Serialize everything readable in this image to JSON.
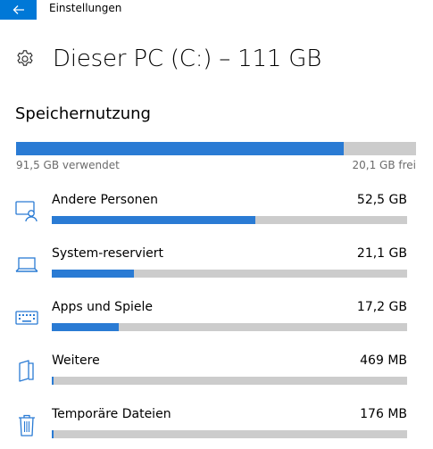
{
  "window": {
    "title": "Einstellungen",
    "back_icon": "back-arrow-icon"
  },
  "header": {
    "icon": "gear-icon",
    "title": "Dieser PC (C:) – 111 GB"
  },
  "usage": {
    "heading": "Speichernutzung",
    "used_fraction": 0.82,
    "used_label": "91,5 GB verwendet",
    "free_label": "20,1 GB frei"
  },
  "categories": [
    {
      "name": "Andere Personen",
      "size": "52,5 GB",
      "fraction": 0.573,
      "icon": "other-users-icon"
    },
    {
      "name": "System-reserviert",
      "size": "21,1 GB",
      "fraction": 0.231,
      "icon": "laptop-icon"
    },
    {
      "name": "Apps und Spiele",
      "size": "17,2 GB",
      "fraction": 0.188,
      "icon": "keyboard-icon"
    },
    {
      "name": "Weitere",
      "size": "469 MB",
      "fraction": 0.006,
      "icon": "folder-icon"
    },
    {
      "name": "Temporäre Dateien",
      "size": "176 MB",
      "fraction": 0.004,
      "icon": "trash-icon"
    }
  ],
  "colors": {
    "accent": "#0078d7",
    "bar_fill": "#2a7bd4",
    "bar_track": "#cccccc",
    "secondary_text": "#6b6b6b"
  }
}
